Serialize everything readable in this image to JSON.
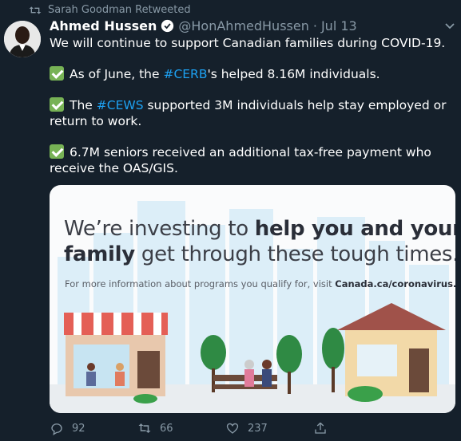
{
  "retweet": {
    "text": "Sarah Goodman Retweeted"
  },
  "tweet": {
    "author_name": "Ahmed Hussen",
    "handle": "@HonAhmedHussen",
    "separator": "·",
    "date": "Jul 13",
    "line1": "We will continue to support Canadian families during COVID-19.",
    "p2_pre": "As of June, the ",
    "p2_hash": "#CERB",
    "p2_post": "'s helped 8.16M individuals.",
    "p3_pre": "The ",
    "p3_hash": "#CEWS",
    "p3_post": " supported 3M individuals help stay employed or return to work.",
    "p4": "6.7M seniors received an additional tax-free payment who receive the OAS/GIS."
  },
  "card": {
    "line1_pre": "We’re investing to ",
    "line1_bold": "help you and your",
    "line2_bold": "family",
    "line2_post": " get through these tough times.",
    "info_pre": "For more information about programs you qualify for, visit ",
    "info_link": "Canada.ca/coronavirus."
  },
  "actions": {
    "replies": "92",
    "retweets": "66",
    "likes": "237"
  },
  "colors": {
    "background": "#15202b",
    "accent": "#1da1f2",
    "muted": "#8899a6"
  }
}
